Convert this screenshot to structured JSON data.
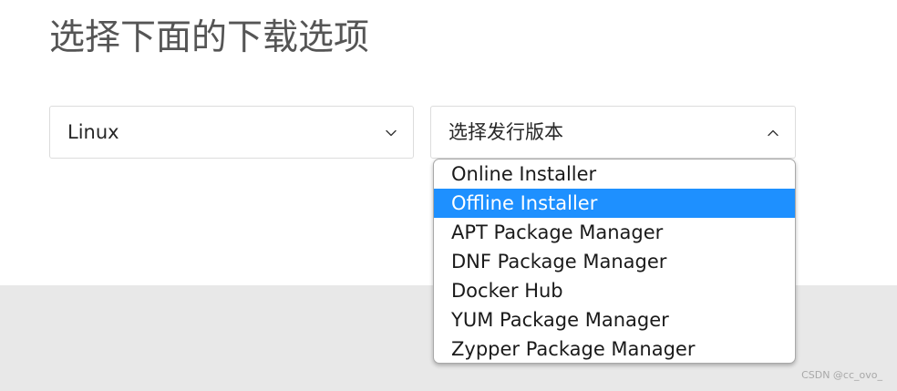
{
  "page": {
    "title": "选择下面的下载选项"
  },
  "os_select": {
    "value": "Linux",
    "icon": "chevron-down-icon"
  },
  "distro_select": {
    "value": "选择发行版本",
    "icon": "chevron-up-icon",
    "expanded": true,
    "options": [
      "Online Installer",
      "Offline Installer",
      "APT Package Manager",
      "DNF Package Manager",
      "Docker Hub",
      "YUM Package Manager",
      "Zypper Package Manager"
    ],
    "highlighted_index": 1
  },
  "colors": {
    "highlight": "#1e90ff",
    "band": "#e8e8e8",
    "title": "#555555"
  },
  "watermark": "CSDN @cc_ovo_"
}
